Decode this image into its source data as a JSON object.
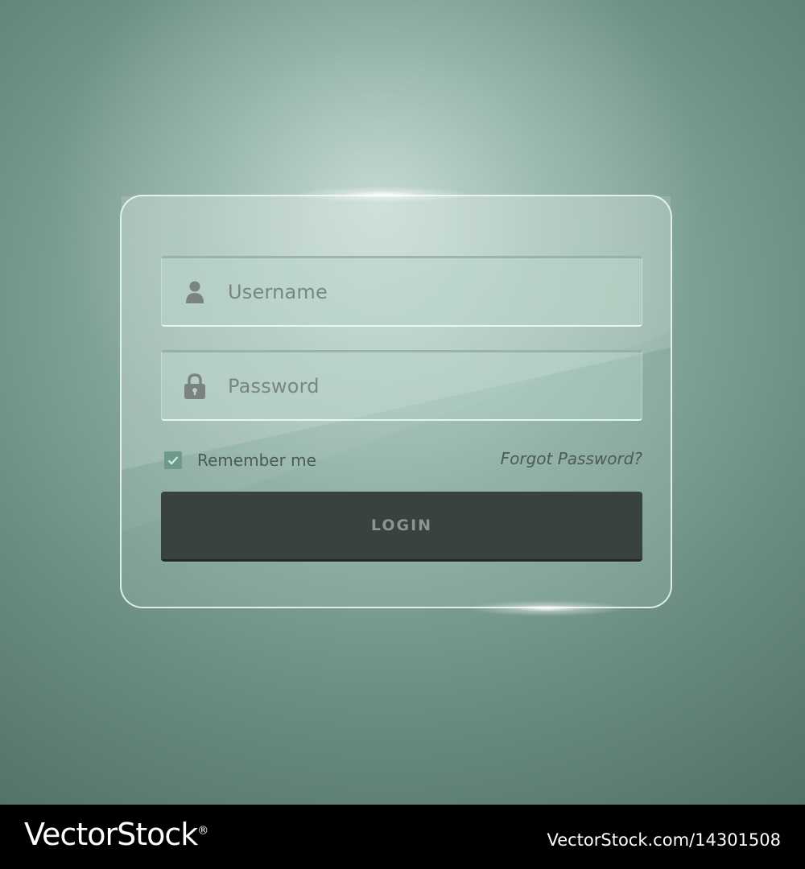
{
  "login_form": {
    "username_placeholder": "Username",
    "password_placeholder": "Password",
    "remember_label": "Remember me",
    "remember_checked": true,
    "forgot_label": "Forgot Password?",
    "login_label": "LOGIN"
  },
  "icons": {
    "username": "user-icon",
    "password": "lock-icon",
    "checkbox": "check-icon"
  },
  "footer": {
    "brand": "VectorStock",
    "reg_mark": "®",
    "image_id": "VectorStock.com/14301508"
  },
  "colors": {
    "background": "#86a79c",
    "button": "#384240",
    "button_text": "#8b9693",
    "checkbox": "#6f998c",
    "text": "#4d5a56"
  }
}
